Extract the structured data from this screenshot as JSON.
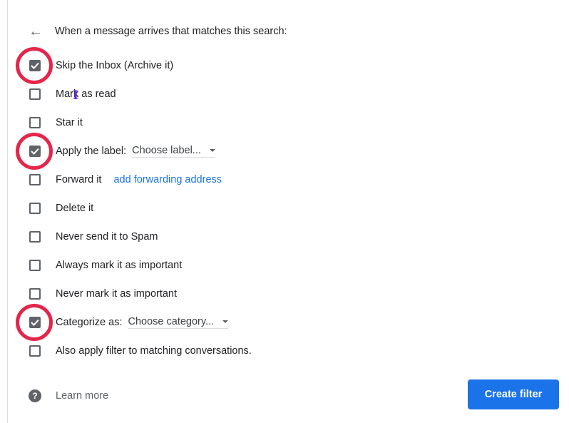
{
  "header": {
    "back_icon": "arrow-back-icon",
    "text": "When a message arrives that matches this search:"
  },
  "actions": [
    {
      "label": "Skip the Inbox (Archive it)",
      "checked": true
    },
    {
      "label": "Mark as read",
      "checked": false
    },
    {
      "label": "Star it",
      "checked": false
    },
    {
      "label": "Apply the label:",
      "checked": true,
      "select": "Choose label..."
    },
    {
      "label": "Forward it",
      "checked": false,
      "link": "add forwarding address"
    },
    {
      "label": "Delete it",
      "checked": false
    },
    {
      "label": "Never send it to Spam",
      "checked": false
    },
    {
      "label": "Always mark it as important",
      "checked": false
    },
    {
      "label": "Never mark it as important",
      "checked": false
    },
    {
      "label": "Categorize as:",
      "checked": true,
      "select": "Choose category..."
    },
    {
      "label": "Also apply filter to matching conversations.",
      "checked": false
    }
  ],
  "footer": {
    "help_icon": "help-circle-icon",
    "learn_more": "Learn more",
    "create_filter": "Create filter"
  },
  "annotation": {
    "cursor_glyph": "I",
    "ring_color": "#e4264a"
  },
  "colors": {
    "accent": "#1a73e8",
    "checkbox": "#5f6368"
  }
}
